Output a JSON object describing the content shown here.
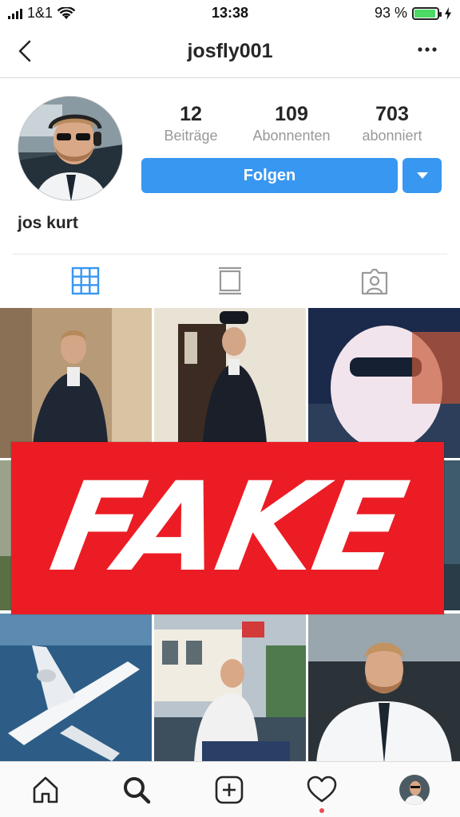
{
  "status_bar": {
    "carrier": "1&1",
    "time": "13:38",
    "battery": "93 %",
    "battery_level": 0.93
  },
  "nav": {
    "username": "josfly001",
    "back_icon": "chevron-left-icon",
    "more_icon": "more-horizontal-icon"
  },
  "profile": {
    "display_name": "jos kurt",
    "stats": [
      {
        "value": "12",
        "label": "Beiträge"
      },
      {
        "value": "109",
        "label": "Abonnenten"
      },
      {
        "value": "703",
        "label": "abonniert"
      }
    ],
    "follow_label": "Folgen",
    "accent_color": "#3897f0"
  },
  "tabs": [
    {
      "icon": "grid-icon",
      "active": true
    },
    {
      "icon": "feed-list-icon",
      "active": false
    },
    {
      "icon": "tagged-photos-icon",
      "active": false
    }
  ],
  "overlay": {
    "text": "FAKE",
    "color": "#ec1c24"
  },
  "bottom_nav": [
    {
      "icon": "home-icon"
    },
    {
      "icon": "search-icon"
    },
    {
      "icon": "add-post-icon"
    },
    {
      "icon": "heart-icon",
      "has_notification": true
    },
    {
      "icon": "profile-avatar-icon"
    }
  ]
}
